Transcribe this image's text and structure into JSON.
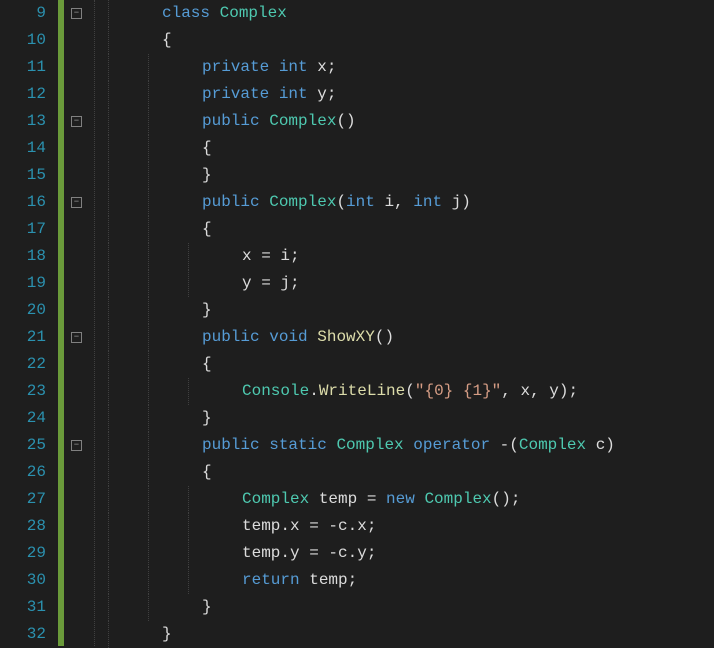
{
  "editorTheme": "dark",
  "lineNumbers": [
    "9",
    "10",
    "11",
    "12",
    "13",
    "14",
    "15",
    "16",
    "17",
    "18",
    "19",
    "20",
    "21",
    "22",
    "23",
    "24",
    "25",
    "26",
    "27",
    "28",
    "29",
    "30",
    "31",
    "32"
  ],
  "foldMarkers": [
    {
      "line": 0,
      "symbol": "−"
    },
    {
      "line": 4,
      "symbol": "−"
    },
    {
      "line": 7,
      "symbol": "−"
    },
    {
      "line": 12,
      "symbol": "−"
    },
    {
      "line": 16,
      "symbol": "−"
    }
  ],
  "code": {
    "lines": [
      {
        "indent": 2,
        "tokens": [
          {
            "t": "class ",
            "c": "kw"
          },
          {
            "t": "Complex",
            "c": "type"
          }
        ]
      },
      {
        "indent": 2,
        "tokens": [
          {
            "t": "{",
            "c": "punct"
          }
        ]
      },
      {
        "indent": 3,
        "tokens": [
          {
            "t": "private ",
            "c": "kw"
          },
          {
            "t": "int ",
            "c": "kw"
          },
          {
            "t": "x;",
            "c": "ident"
          }
        ]
      },
      {
        "indent": 3,
        "tokens": [
          {
            "t": "private ",
            "c": "kw"
          },
          {
            "t": "int ",
            "c": "kw"
          },
          {
            "t": "y;",
            "c": "ident"
          }
        ]
      },
      {
        "indent": 3,
        "tokens": [
          {
            "t": "public ",
            "c": "kw"
          },
          {
            "t": "Complex",
            "c": "type"
          },
          {
            "t": "()",
            "c": "punct"
          }
        ]
      },
      {
        "indent": 3,
        "tokens": [
          {
            "t": "{",
            "c": "punct"
          }
        ]
      },
      {
        "indent": 3,
        "tokens": [
          {
            "t": "}",
            "c": "punct"
          }
        ]
      },
      {
        "indent": 3,
        "tokens": [
          {
            "t": "public ",
            "c": "kw"
          },
          {
            "t": "Complex",
            "c": "type"
          },
          {
            "t": "(",
            "c": "punct"
          },
          {
            "t": "int ",
            "c": "kw"
          },
          {
            "t": "i, ",
            "c": "ident"
          },
          {
            "t": "int ",
            "c": "kw"
          },
          {
            "t": "j)",
            "c": "ident"
          }
        ]
      },
      {
        "indent": 3,
        "tokens": [
          {
            "t": "{",
            "c": "punct"
          }
        ]
      },
      {
        "indent": 4,
        "tokens": [
          {
            "t": "x = i;",
            "c": "ident"
          }
        ]
      },
      {
        "indent": 4,
        "tokens": [
          {
            "t": "y = j;",
            "c": "ident"
          }
        ]
      },
      {
        "indent": 3,
        "tokens": [
          {
            "t": "}",
            "c": "punct"
          }
        ]
      },
      {
        "indent": 3,
        "tokens": [
          {
            "t": "public ",
            "c": "kw"
          },
          {
            "t": "void ",
            "c": "kw"
          },
          {
            "t": "ShowXY",
            "c": "method"
          },
          {
            "t": "()",
            "c": "punct"
          }
        ]
      },
      {
        "indent": 3,
        "tokens": [
          {
            "t": "{",
            "c": "punct"
          }
        ]
      },
      {
        "indent": 4,
        "tokens": [
          {
            "t": "Console",
            "c": "type"
          },
          {
            "t": ".",
            "c": "punct"
          },
          {
            "t": "WriteLine",
            "c": "method"
          },
          {
            "t": "(",
            "c": "punct"
          },
          {
            "t": "\"{0} {1}\"",
            "c": "str"
          },
          {
            "t": ", x, y);",
            "c": "ident"
          }
        ]
      },
      {
        "indent": 3,
        "tokens": [
          {
            "t": "}",
            "c": "punct"
          }
        ]
      },
      {
        "indent": 3,
        "tokens": [
          {
            "t": "public ",
            "c": "kw"
          },
          {
            "t": "static ",
            "c": "kw"
          },
          {
            "t": "Complex ",
            "c": "type"
          },
          {
            "t": "operator ",
            "c": "kw"
          },
          {
            "t": "-(",
            "c": "punct"
          },
          {
            "t": "Complex ",
            "c": "type"
          },
          {
            "t": "c)",
            "c": "ident"
          }
        ]
      },
      {
        "indent": 3,
        "tokens": [
          {
            "t": "{",
            "c": "punct"
          }
        ]
      },
      {
        "indent": 4,
        "tokens": [
          {
            "t": "Complex ",
            "c": "type"
          },
          {
            "t": "temp = ",
            "c": "ident"
          },
          {
            "t": "new ",
            "c": "kw"
          },
          {
            "t": "Complex",
            "c": "type"
          },
          {
            "t": "();",
            "c": "punct"
          }
        ]
      },
      {
        "indent": 4,
        "tokens": [
          {
            "t": "temp.x = -c.x;",
            "c": "ident"
          }
        ]
      },
      {
        "indent": 4,
        "tokens": [
          {
            "t": "temp.y = -c.y;",
            "c": "ident"
          }
        ]
      },
      {
        "indent": 4,
        "tokens": [
          {
            "t": "return ",
            "c": "kw"
          },
          {
            "t": "temp;",
            "c": "ident"
          }
        ]
      },
      {
        "indent": 3,
        "tokens": [
          {
            "t": "}",
            "c": "punct"
          }
        ]
      },
      {
        "indent": 2,
        "tokens": [
          {
            "t": "}",
            "c": "punct"
          }
        ]
      }
    ]
  },
  "indentWidth": 40
}
